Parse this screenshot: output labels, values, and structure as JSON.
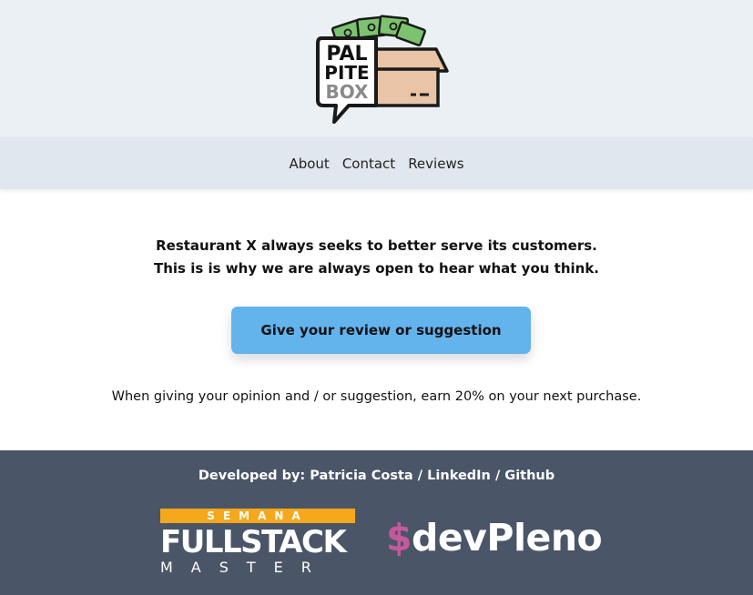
{
  "logo": {
    "line1": "PAL",
    "line2": "PITE",
    "line3": "BOX"
  },
  "nav": {
    "items": [
      "About",
      "Contact",
      "Reviews"
    ]
  },
  "main": {
    "intro_line1": "Restaurant X always seeks to better serve its customers.",
    "intro_line2": "This is is why we are always open to hear what you think.",
    "cta_label": "Give your review or suggestion",
    "promo": "When giving your opinion and / or suggestion, earn 20% on your next purchase."
  },
  "footer": {
    "developed_by_label": "Developed by:",
    "author": "Patricia Costa",
    "sep1": "/",
    "linkedin": "LinkedIn",
    "sep2": "/",
    "github": "Github",
    "fullstack": {
      "band": "SEMANA",
      "main": "FULLSTACK",
      "sub": "MASTER"
    },
    "devpleno": {
      "dollar": "$",
      "name": "devPleno"
    }
  },
  "colors": {
    "header_bg": "#ebf0f5",
    "nav_bg": "#e1e7ef",
    "cta_bg": "#63b3ed",
    "footer_bg": "#4a5568",
    "fullstack_band": "#f6a81c",
    "devpleno_dollar": "#c5599c"
  }
}
